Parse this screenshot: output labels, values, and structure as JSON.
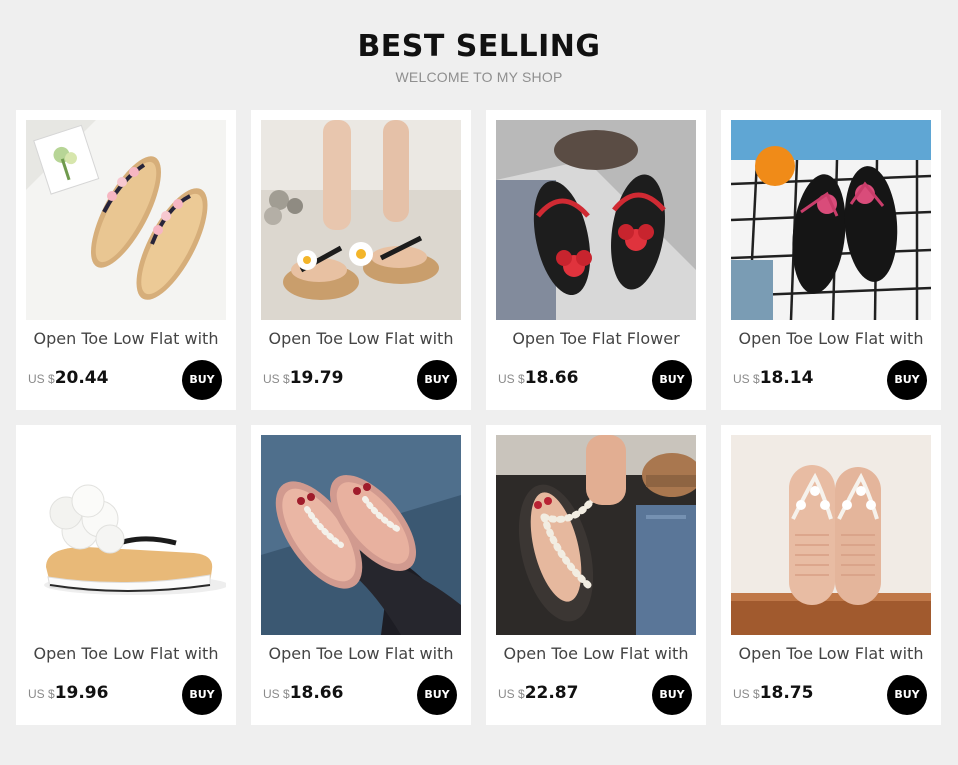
{
  "header": {
    "title": "BEST SELLING",
    "subtitle": "WELCOME TO MY SHOP"
  },
  "colors": {
    "page_background": "#efefef",
    "card_background": "#ffffff",
    "buy_button": "#000000",
    "price_text": "#111111"
  },
  "products": [
    {
      "name": "Open Toe Low Flat with",
      "currency": "US $",
      "price": "20.44",
      "buy_label": "BUY",
      "image": "flower-strap-flip-flops-on-white-image"
    },
    {
      "name": "Open Toe Low Flat with",
      "currency": "US $",
      "price": "19.79",
      "buy_label": "BUY",
      "image": "daisy-flip-flops-worn-image"
    },
    {
      "name": "Open Toe Flat Flower",
      "currency": "US $",
      "price": "18.66",
      "buy_label": "BUY",
      "image": "red-flower-black-sandals-image"
    },
    {
      "name": "Open Toe Low Flat with",
      "currency": "US $",
      "price": "18.14",
      "buy_label": "BUY",
      "image": "black-flip-flops-pool-tiles-image"
    },
    {
      "name": "Open Toe Low Flat with",
      "currency": "US $",
      "price": "19.96",
      "buy_label": "BUY",
      "image": "white-flower-platform-slipper-image"
    },
    {
      "name": "Open Toe Low Flat with",
      "currency": "US $",
      "price": "18.66",
      "buy_label": "BUY",
      "image": "pearl-thong-sandals-worn-image"
    },
    {
      "name": "Open Toe Low Flat with",
      "currency": "US $",
      "price": "22.87",
      "buy_label": "BUY",
      "image": "beaded-thong-sandals-jeans-image"
    },
    {
      "name": "Open Toe Low Flat with",
      "currency": "US $",
      "price": "18.75",
      "buy_label": "BUY",
      "image": "pink-flower-flip-flops-image"
    }
  ]
}
